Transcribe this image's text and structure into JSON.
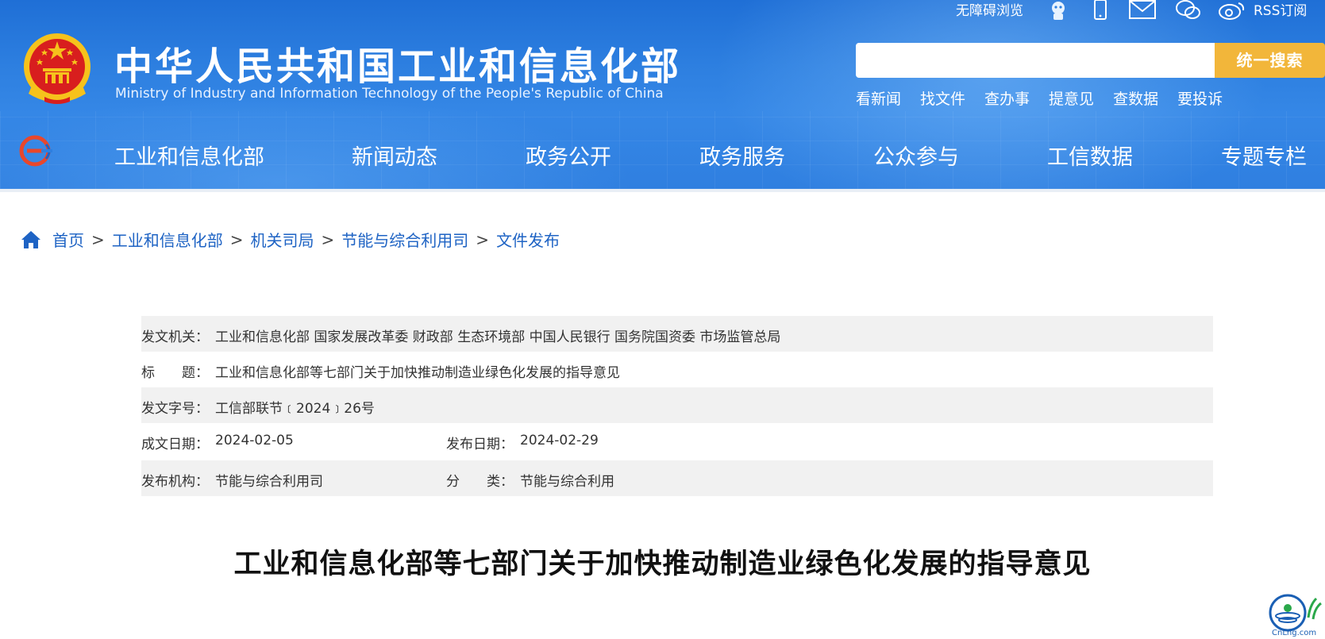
{
  "header": {
    "title_cn": "中华人民共和国工业和信息化部",
    "title_en": "Ministry of Industry and Information Technology of the People's Republic of China",
    "accessibility": "无障碍浏览",
    "rss": "RSS订阅",
    "icons": [
      "robot-icon",
      "mobile-icon",
      "mail-icon",
      "wechat-icon",
      "weibo-icon"
    ],
    "search": {
      "placeholder": "",
      "button": "统一搜索"
    },
    "quicklinks": [
      "看新闻",
      "找文件",
      "查办事",
      "提意见",
      "查数据",
      "要投诉"
    ],
    "nav": [
      "工业和信息化部",
      "新闻动态",
      "政务公开",
      "政务服务",
      "公众参与",
      "工信数据",
      "专题专栏"
    ]
  },
  "breadcrumb": {
    "home": "首页",
    "items": [
      "工业和信息化部",
      "机关司局",
      "节能与综合利用司",
      "文件发布"
    ],
    "separator": ">"
  },
  "info": {
    "issuer_label": "发文机关：",
    "issuer": "工业和信息化部 国家发展改革委 财政部 生态环境部 中国人民银行 国务院国资委 市场监管总局",
    "title_label": "标　　题：",
    "title": "工业和信息化部等七部门关于加快推动制造业绿色化发展的指导意见",
    "docno_label": "发文字号：",
    "docno": "工信部联节﹝2024﹞26号",
    "created_label": "成文日期：",
    "created": "2024-02-05",
    "published_label": "发布日期：",
    "published": "2024-02-29",
    "org_label": "发布机构：",
    "org": "节能与综合利用司",
    "category_label": "分　　类：",
    "category": "节能与综合利用"
  },
  "doc_title": "工业和信息化部等七部门关于加快推动制造业绿色化发展的指导意见",
  "watermark": "CnLng.com",
  "colors": {
    "header_blue": "#2d7fe0",
    "search_button": "#f2b63a",
    "link_blue": "#1e63c4",
    "row_shade": "#f1f1f1"
  }
}
